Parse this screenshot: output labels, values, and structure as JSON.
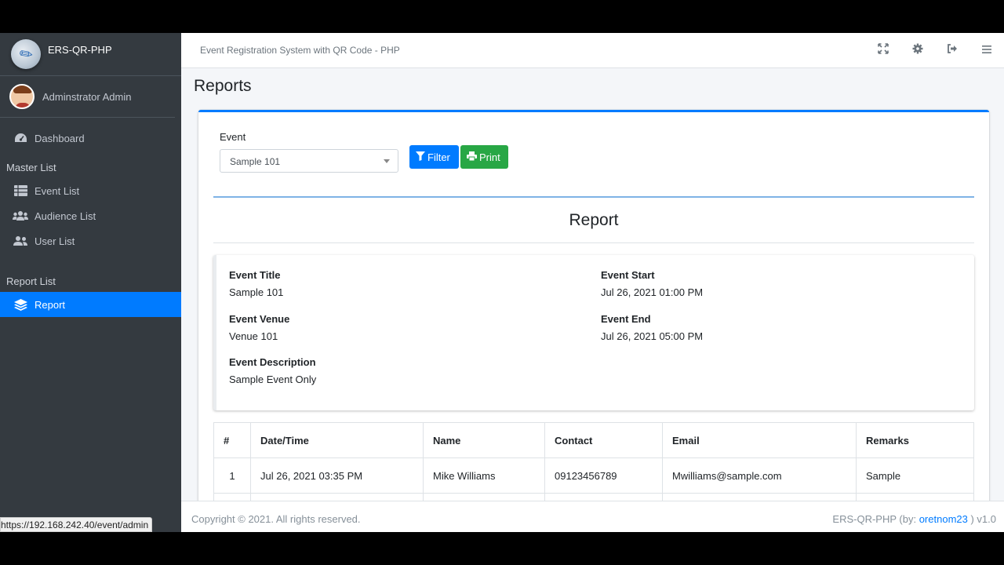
{
  "app": {
    "brand": "ERS-QR-PHP",
    "system_title": "Event Registration System with QR Code - PHP",
    "status_url": "https://192.168.242.40/event/admin"
  },
  "sidebar": {
    "user_name": "Adminstrator Admin",
    "dashboard": "Dashboard",
    "master_header": "Master List",
    "master_items": [
      {
        "label": "Event List",
        "icon": "table-icon"
      },
      {
        "label": "Audience List",
        "icon": "users-icon"
      },
      {
        "label": "User List",
        "icon": "user-friends-icon"
      }
    ],
    "report_header": "Report List",
    "report_item": "Report"
  },
  "page": {
    "title": "Reports",
    "event_label": "Event",
    "event_selected": "Sample 101",
    "filter_label": "Filter",
    "print_label": "Print",
    "report_heading": "Report"
  },
  "event_info": {
    "title_label": "Event Title",
    "title_value": "Sample 101",
    "venue_label": "Event Venue",
    "venue_value": "Venue 101",
    "desc_label": "Event Description",
    "desc_value": "Sample Event Only",
    "start_label": "Event Start",
    "start_value": "Jul 26, 2021 01:00 PM",
    "end_label": "Event End",
    "end_value": "Jul 26, 2021 05:00 PM"
  },
  "table": {
    "headers": [
      "#",
      "Date/Time",
      "Name",
      "Contact",
      "Email",
      "Remarks"
    ],
    "rows": [
      [
        "1",
        "Jul 26, 2021 03:35 PM",
        "Mike Williams",
        "09123456789",
        "Mwilliams@sample.com",
        "Sample"
      ]
    ]
  },
  "footer": {
    "copyright": "Copyright © 2021. All rights reserved.",
    "credit_prefix": "ERS-QR-PHP (by:",
    "credit_link": "oretnom23",
    "credit_suffix": ") v1.0"
  },
  "colors": {
    "sidebar_bg": "#343a40",
    "accent": "#007bff",
    "print_button": "#28a745"
  }
}
